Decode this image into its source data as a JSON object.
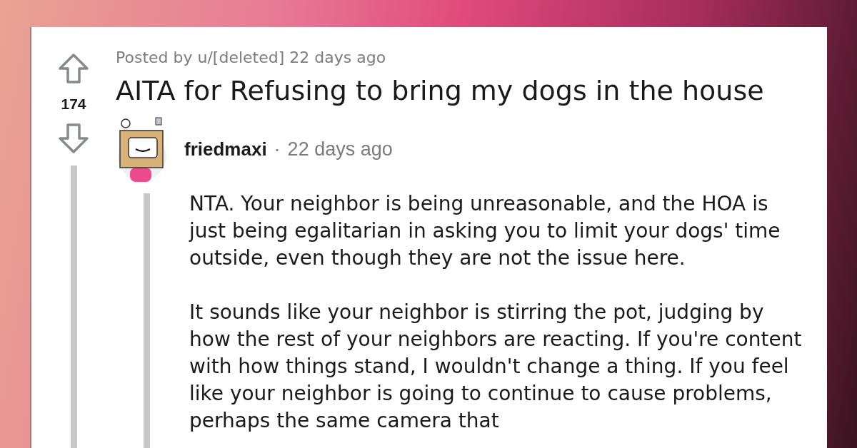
{
  "post": {
    "score": "174",
    "meta": "Posted by u/[deleted] 22 days ago",
    "title": "AITA for Refusing to bring my dogs in the house"
  },
  "comment": {
    "author": "friedmaxi",
    "separator": "·",
    "time": "22 days ago",
    "paragraphs": [
      "NTA. Your neighbor is being unreasonable, and the HOA is just being egalitarian in asking you to limit your dogs' time outside, even though they are not the issue here.",
      "It sounds like your neighbor is stirring the pot, judging by how the rest of your neighbors are reacting. If you're content with how things stand, I wouldn't change a thing. If you feel like your neighbor is going to continue to cause problems, perhaps the same camera that"
    ]
  }
}
